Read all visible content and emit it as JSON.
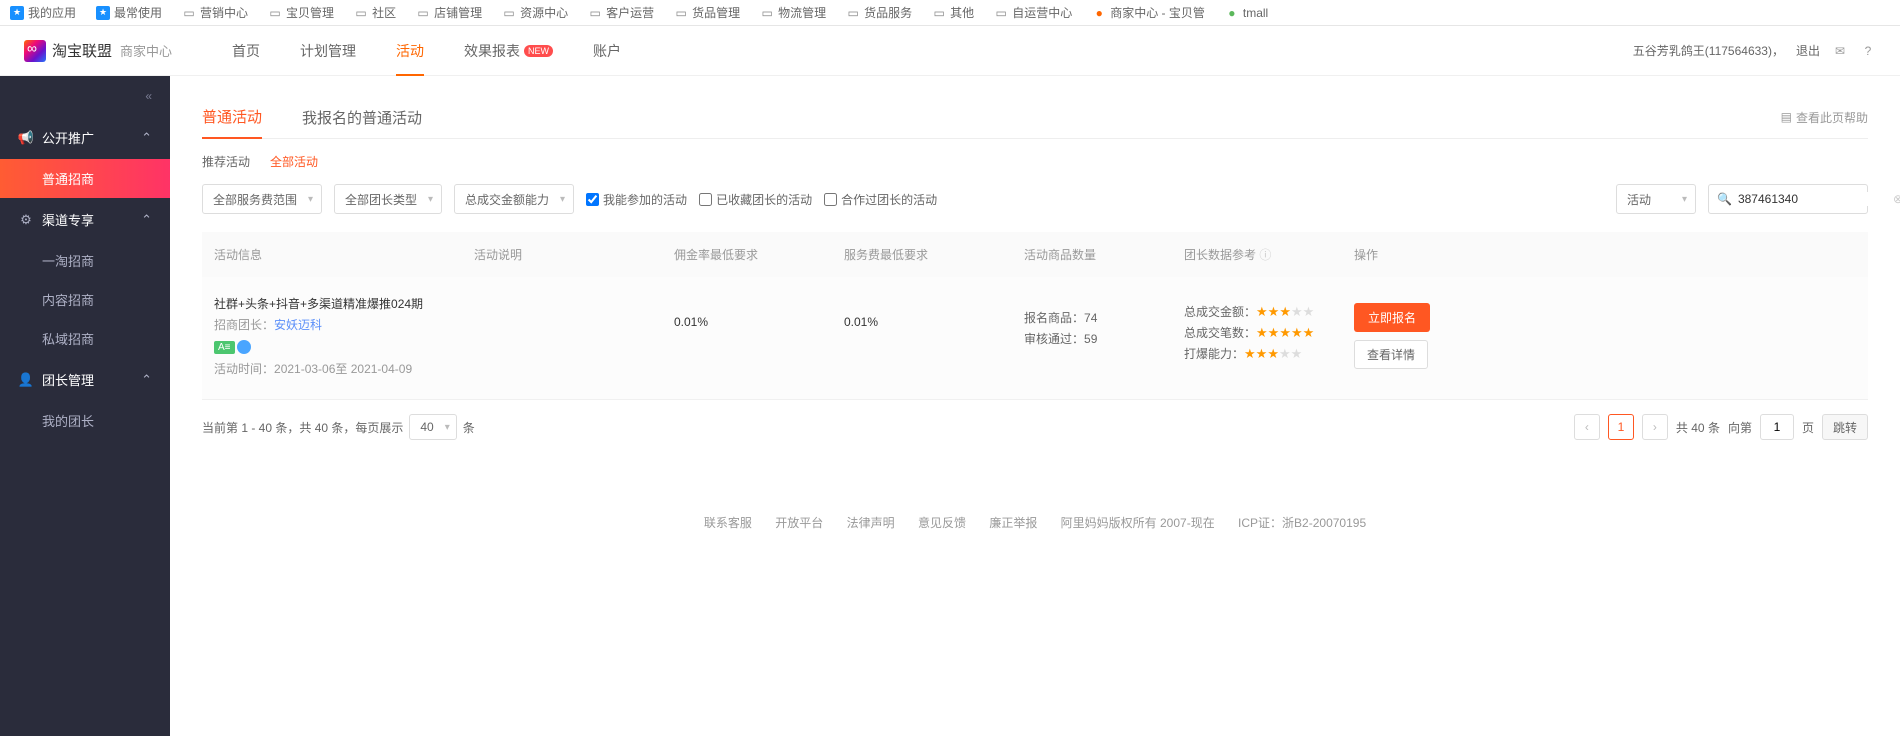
{
  "bookmarks": [
    "我的应用",
    "最常使用",
    "营销中心",
    "宝贝管理",
    "社区",
    "店铺管理",
    "资源中心",
    "客户运营",
    "货品管理",
    "物流管理",
    "货品服务",
    "其他",
    "自运营中心",
    "商家中心 - 宝贝管",
    "tmall"
  ],
  "logo": {
    "title": "淘宝联盟",
    "sub": "商家中心"
  },
  "nav": {
    "items": [
      {
        "label": "首页"
      },
      {
        "label": "计划管理"
      },
      {
        "label": "活动",
        "active": true
      },
      {
        "label": "效果报表",
        "badge": "NEW"
      },
      {
        "label": "账户"
      }
    ]
  },
  "user": {
    "name": "五谷芳乳鸽王",
    "id": "117564633",
    "logout": "退出"
  },
  "sidebar": {
    "groups": [
      {
        "label": "公开推广",
        "open": true,
        "items": [
          {
            "label": "普通招商",
            "active": true
          }
        ]
      },
      {
        "label": "渠道专享",
        "open": true,
        "items": [
          {
            "label": "一淘招商"
          },
          {
            "label": "内容招商"
          },
          {
            "label": "私域招商"
          }
        ]
      },
      {
        "label": "团长管理",
        "open": true,
        "items": [
          {
            "label": "我的团长"
          }
        ]
      }
    ]
  },
  "tabs": {
    "items": [
      {
        "label": "普通活动",
        "active": true
      },
      {
        "label": "我报名的普通活动"
      }
    ],
    "help": "查看此页帮助"
  },
  "subtabs": {
    "items": [
      {
        "label": "推荐活动"
      },
      {
        "label": "全部活动",
        "active": true
      }
    ]
  },
  "filters": {
    "selects": [
      "全部服务费范围",
      "全部团长类型",
      "总成交金额能力"
    ],
    "checks": [
      {
        "label": "我能参加的活动",
        "checked": true
      },
      {
        "label": "已收藏团长的活动",
        "checked": false
      },
      {
        "label": "合作过团长的活动",
        "checked": false
      }
    ],
    "right_select": "活动",
    "search_value": "387461340"
  },
  "table": {
    "headers": [
      "活动信息",
      "活动说明",
      "佣金率最低要求",
      "服务费最低要求",
      "活动商品数量",
      "团长数据参考",
      "操作"
    ],
    "row": {
      "title": "社群+头条+抖音+多渠道精准爆推024期",
      "leader_lbl": "招商团长：",
      "leader": "安妖迈科",
      "time_lbl": "活动时间：",
      "time": "2021-03-06至 2021-04-09",
      "commission": "0.01%",
      "service": "0.01%",
      "qty_lbl1": "报名商品：",
      "qty1": "74",
      "qty_lbl2": "审核通过：",
      "qty2": "59",
      "data": [
        {
          "label": "总成交金额：",
          "stars": 3
        },
        {
          "label": "总成交笔数：",
          "stars": 5
        },
        {
          "label": "打爆能力：",
          "stars": 3
        }
      ],
      "btn1": "立即报名",
      "btn2": "查看详情"
    }
  },
  "pager": {
    "info_pre": "当前第 1 - 40 条，共 40 条，每页展示",
    "size": "40",
    "info_suf": "条",
    "total": "共 40 条",
    "goto_pre": "向第",
    "goto_val": "1",
    "goto_suf": "页",
    "jump": "跳转"
  },
  "footer": [
    "联系客服",
    "开放平台",
    "法律声明",
    "意见反馈",
    "廉正举报",
    "阿里妈妈版权所有 2007-现在",
    "ICP证：浙B2-20070195"
  ]
}
